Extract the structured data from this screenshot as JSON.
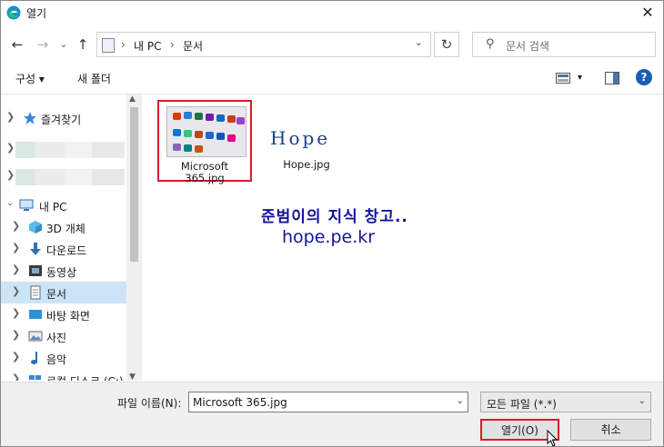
{
  "window": {
    "title": "열기",
    "close_glyph": "✕"
  },
  "nav": {
    "back": "←",
    "forward": "→",
    "recent": "⌄",
    "up": "↑",
    "breadcrumb_sep1": "›",
    "breadcrumb_pc": "내 PC",
    "breadcrumb_sep2": "›",
    "breadcrumb_docs": "문서",
    "refresh": "↻"
  },
  "search": {
    "placeholder": "문서 검색"
  },
  "toolbar": {
    "organize_label": "구성 ▾",
    "new_folder_label": "새 폴더",
    "view_dropdown": "▾",
    "help": "?"
  },
  "tree": {
    "items": [
      {
        "label": "즐겨찾기",
        "icon": "star-icon"
      },
      {
        "label": "",
        "icon": "blurred"
      },
      {
        "label": "",
        "icon": "blurred"
      },
      {
        "label": "내 PC",
        "icon": "computer-icon"
      },
      {
        "label": "3D 개체",
        "icon": "cube-3d-icon"
      },
      {
        "label": "다운로드",
        "icon": "download-icon"
      },
      {
        "label": "동영상",
        "icon": "video-icon"
      },
      {
        "label": "문서",
        "icon": "document-icon"
      },
      {
        "label": "바탕 화면",
        "icon": "desktop-icon"
      },
      {
        "label": "사진",
        "icon": "picture-icon"
      },
      {
        "label": "음악",
        "icon": "music-icon"
      },
      {
        "label": "로컬 디스크 (C:)",
        "icon": "drive-icon"
      }
    ]
  },
  "files": [
    {
      "name_line1": "Microsoft",
      "name_line2": "365.jpg",
      "selected": true
    },
    {
      "name_line1": "Hope.jpg",
      "name_line2": "",
      "selected": false
    }
  ],
  "hope_logo_text": "Hope",
  "watermark": {
    "line1": "준범이의 지식 창고..",
    "line2": "hope.pe.kr"
  },
  "footer": {
    "filename_label": "파일 이름(N):",
    "filename_value": "Microsoft 365.jpg",
    "filetype_value": "모든 파일 (*.*)",
    "open_label": "열기(O)",
    "cancel_label": "취소"
  },
  "colors": {
    "selection_red": "#d0202a",
    "tree_selected": "#cce4f7",
    "watermark_blue": "#15149a"
  }
}
